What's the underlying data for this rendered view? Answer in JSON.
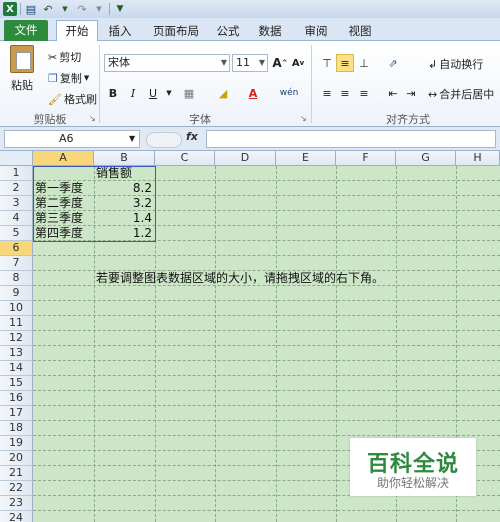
{
  "quick_access": {
    "app_icon": "X",
    "save_icon": "save-icon",
    "undo_icon": "undo-icon",
    "redo_icon": "redo-icon",
    "customize_icon": "customize-icon"
  },
  "tabs": [
    "文件",
    "开始",
    "插入",
    "页面布局",
    "公式",
    "数据",
    "审阅",
    "视图"
  ],
  "active_tab": "开始",
  "ribbon": {
    "clipboard": {
      "paste": "粘贴",
      "cut": "剪切",
      "copy": "复制",
      "format_painter": "格式刷",
      "group_label": "剪贴板"
    },
    "font": {
      "name": "宋体",
      "size": "11",
      "grow": "A",
      "shrink": "A",
      "bold": "B",
      "italic": "I",
      "underline": "U",
      "phonetic": "wén",
      "group_label": "字体"
    },
    "alignment": {
      "wrap_text": "自动换行",
      "merge_center": "合并后居中",
      "group_label": "对齐方式"
    }
  },
  "formula_bar": {
    "name_box": "A6",
    "fx": "fx",
    "content": ""
  },
  "columns": [
    "A",
    "B",
    "C",
    "D",
    "E",
    "F",
    "G",
    "H"
  ],
  "rows": [
    "1",
    "2",
    "3",
    "4",
    "5",
    "6",
    "7",
    "8",
    "9",
    "10",
    "11",
    "12",
    "13",
    "14",
    "15",
    "16",
    "17",
    "18",
    "19",
    "20",
    "21",
    "22",
    "23",
    "24"
  ],
  "selected_cell": {
    "column": "A",
    "row": "6"
  },
  "cells": {
    "B1": "销售额",
    "A2": "第一季度",
    "B2": "8.2",
    "A3": "第二季度",
    "B3": "3.2",
    "A4": "第三季度",
    "B4": "1.4",
    "A5": "第四季度",
    "B5": "1.2",
    "B8": "若要调整图表数据区域的大小，请拖拽区域的右下角。"
  },
  "watermark": {
    "title": "百科全说",
    "subtitle": "助你轻松解决"
  },
  "colors": {
    "file_tab": "#2e8b3e",
    "grid_bg": "#cde6c8",
    "selection_highlight": "#f8d77a",
    "range_border": "#3a57c4"
  }
}
